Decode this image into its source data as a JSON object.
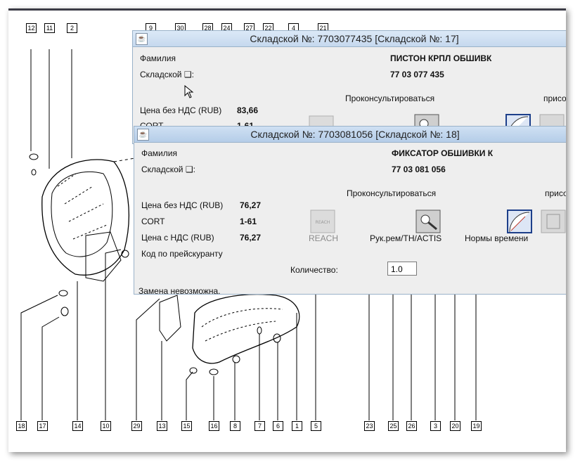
{
  "drawing": {
    "top_callouts": [
      "9",
      "30",
      "28",
      "24",
      "27",
      "22",
      "4",
      "21"
    ],
    "left_top_callouts": [
      "12",
      "11",
      "2"
    ],
    "bottom_callouts": [
      "18",
      "17",
      "14",
      "10",
      "29",
      "13",
      "15",
      "16",
      "8",
      "7",
      "6",
      "1",
      "5",
      "23",
      "25",
      "26",
      "3",
      "20",
      "19"
    ]
  },
  "window1": {
    "title": "Складской №: 7703077435 [Складской №: 17]",
    "label_surname": "Фамилия",
    "label_stock": "Складской ❑:",
    "part_name": "ПИСТОН КРПЛ ОБШИВК",
    "part_number": "77 03 077 435",
    "consult_label": "Проконсультироваться",
    "attach_label": "присо",
    "price_no_vat_label": "Цена без НДС (RUB)",
    "price_no_vat_value": "83,66",
    "sort_label": "СОRT",
    "sort_value": "1-61"
  },
  "window2": {
    "title": "Складской №: 7703081056 [Складской №: 18]",
    "label_surname": "Фамилия",
    "label_stock": "Складской ❑:",
    "part_name": "ФИКСАТОР ОБШИВКИ К",
    "part_number": "77 03 081 056",
    "consult_label": "Проконсультироваться",
    "attach_label": "присо",
    "price_no_vat_label": "Цена без НДС (RUB)",
    "price_no_vat_value": "76,27",
    "sort_label": "СОRT",
    "sort_value": "1-61",
    "price_vat_label": "Цена с НДС (RUB)",
    "price_vat_value": "76,27",
    "price_list_code_label": "Код по прейскуранту",
    "reach_label": "REACH",
    "repair_manual_label": "Рук.рем/TH/ACTIS",
    "time_norms_label": "Нормы времени",
    "quantity_label": "Количество:",
    "quantity_value": "1.0",
    "replacement_note": "Замена невозможна."
  }
}
